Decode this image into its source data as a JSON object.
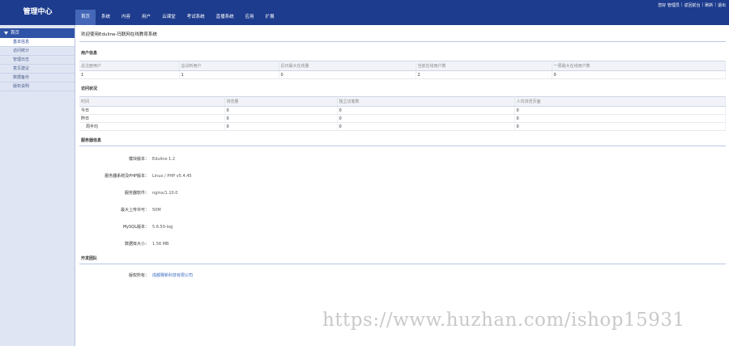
{
  "header": {
    "logo": "管理中心",
    "nav": [
      "首页",
      "系统",
      "内容",
      "用户",
      "云课堂",
      "考试系统",
      "直播系统",
      "应用",
      "扩展"
    ],
    "active_nav": 0,
    "toplinks": {
      "greeting": "您好 管理员",
      "sep1": "|",
      "front": "返回前台",
      "sep2": "|",
      "refresh": "刷新",
      "sep3": "|",
      "logout": "退出"
    }
  },
  "sidebar": {
    "head": "首页",
    "items": [
      "基本信息",
      "访问统计",
      "管理日志",
      "意见建议",
      "数据备份",
      "版权说明"
    ],
    "active_item": 0
  },
  "main": {
    "welcome": "欢迎使用Eduline-玛联网在线教育系统",
    "user_section": {
      "title": "用户信息",
      "headers": [
        "总注册用户",
        "总试听用户",
        "近日最大在线量",
        "当前在线用户数",
        "一周最大在线用户数"
      ],
      "values": [
        "1",
        "1",
        "0",
        "2",
        "0"
      ]
    },
    "visit_section": {
      "title": "访问状况",
      "headers": [
        "时间",
        "浏览量",
        "独立访客数",
        "人均浏览页面"
      ],
      "rows": [
        [
          "今日",
          "0",
          "0",
          "0"
        ],
        [
          "昨日",
          "0",
          "0",
          "0"
        ],
        [
          "周平均",
          "0",
          "0",
          "0"
        ]
      ]
    },
    "server_section": {
      "title": "服务器信息",
      "rows": [
        {
          "label": "模块版本：",
          "value": "Eduline 1.2"
        },
        {
          "label": "服务器系统及PHP版本：",
          "value": "Linux / PHP v5.4.45"
        },
        {
          "label": "服务器软件：",
          "value": "nginx/1.10.0"
        },
        {
          "label": "最大上传许可：",
          "value": "50M"
        },
        {
          "label": "MySQL版本：",
          "value": "5.6.50-log"
        },
        {
          "label": "数据库大小：",
          "value": "1.56 MB"
        }
      ]
    },
    "dev_section": {
      "title": "开发团队",
      "label": "版权所有：",
      "value": "成都赛新科技有限公司"
    }
  },
  "watermark": "https://www.huzhan.com/ishop15931"
}
